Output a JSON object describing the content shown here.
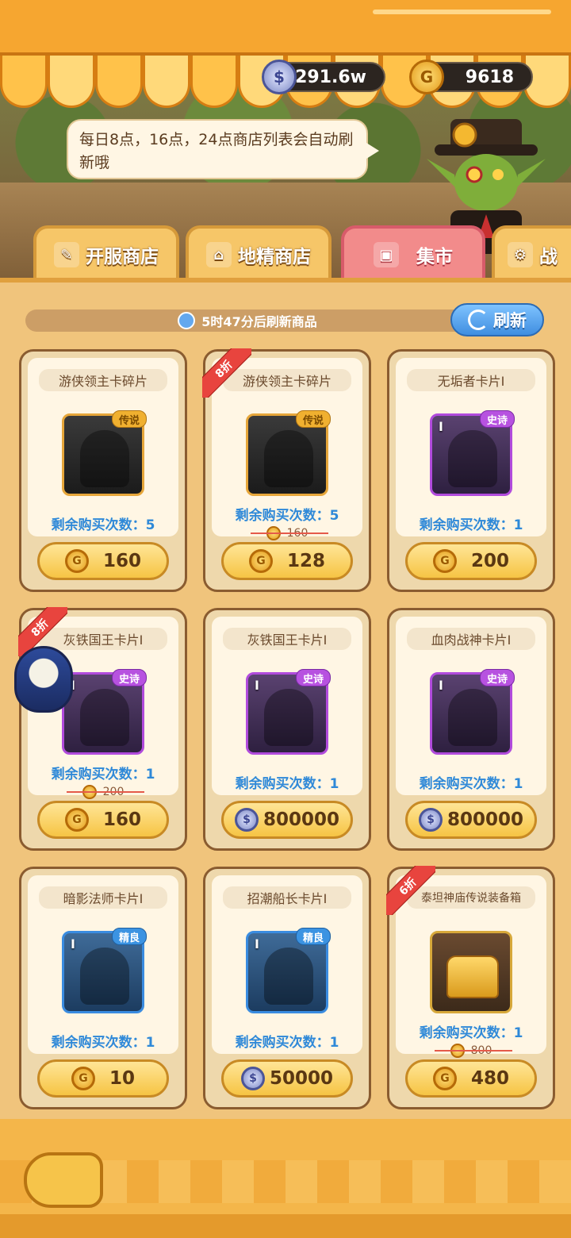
{
  "currency": {
    "silver_amount": "291.6w",
    "gold_amount": "9618"
  },
  "npc_message": "每日8点，16点，24点商店列表会自动刷新哦",
  "tabs": [
    {
      "label": "开服商店",
      "icon": "scroll-icon",
      "active": false
    },
    {
      "label": "地精商店",
      "icon": "shop-icon",
      "active": false
    },
    {
      "label": "集市",
      "icon": "gift-icon",
      "active": true
    },
    {
      "label": "战",
      "icon": "gear-icon",
      "active": false
    }
  ],
  "refresh": {
    "timer_text": "5时47分后刷新商品",
    "button_label": "刷新"
  },
  "items": [
    {
      "name": "游侠领主卡碎片",
      "rarity": "传说",
      "remain": "剩余购买次数：5",
      "currency": "gold",
      "price": "160",
      "discount": "",
      "old_price": ""
    },
    {
      "name": "游侠领主卡碎片",
      "rarity": "传说",
      "remain": "剩余购买次数：5",
      "currency": "gold",
      "price": "128",
      "discount": "8折",
      "old_price": "160"
    },
    {
      "name": "无垢者卡片Ⅰ",
      "rarity": "史诗",
      "remain": "剩余购买次数：1",
      "currency": "gold",
      "price": "200",
      "discount": "",
      "old_price": ""
    },
    {
      "name": "灰铁国王卡片Ⅰ",
      "rarity": "史诗",
      "remain": "剩余购买次数：1",
      "currency": "gold",
      "price": "160",
      "discount": "8折",
      "old_price": "200"
    },
    {
      "name": "灰铁国王卡片Ⅰ",
      "rarity": "史诗",
      "remain": "剩余购买次数：1",
      "currency": "silver",
      "price": "800000",
      "discount": "",
      "old_price": ""
    },
    {
      "name": "血肉战神卡片Ⅰ",
      "rarity": "史诗",
      "remain": "剩余购买次数：1",
      "currency": "silver",
      "price": "800000",
      "discount": "",
      "old_price": ""
    },
    {
      "name": "暗影法师卡片Ⅰ",
      "rarity": "精良",
      "remain": "剩余购买次数：1",
      "currency": "gold",
      "price": "10",
      "discount": "",
      "old_price": ""
    },
    {
      "name": "招潮船长卡片Ⅰ",
      "rarity": "精良",
      "remain": "剩余购买次数：1",
      "currency": "silver",
      "price": "50000",
      "discount": "",
      "old_price": ""
    },
    {
      "name": "泰坦神庙传说装备箱",
      "rarity": "",
      "remain": "剩余购买次数：1",
      "currency": "gold",
      "price": "480",
      "discount": "6折",
      "old_price": "800"
    }
  ],
  "tier_mark": "I",
  "colors": {
    "accent_blue": "#2f89d8",
    "discount_red": "#e8443e",
    "awning_orange": "#f6a630"
  }
}
